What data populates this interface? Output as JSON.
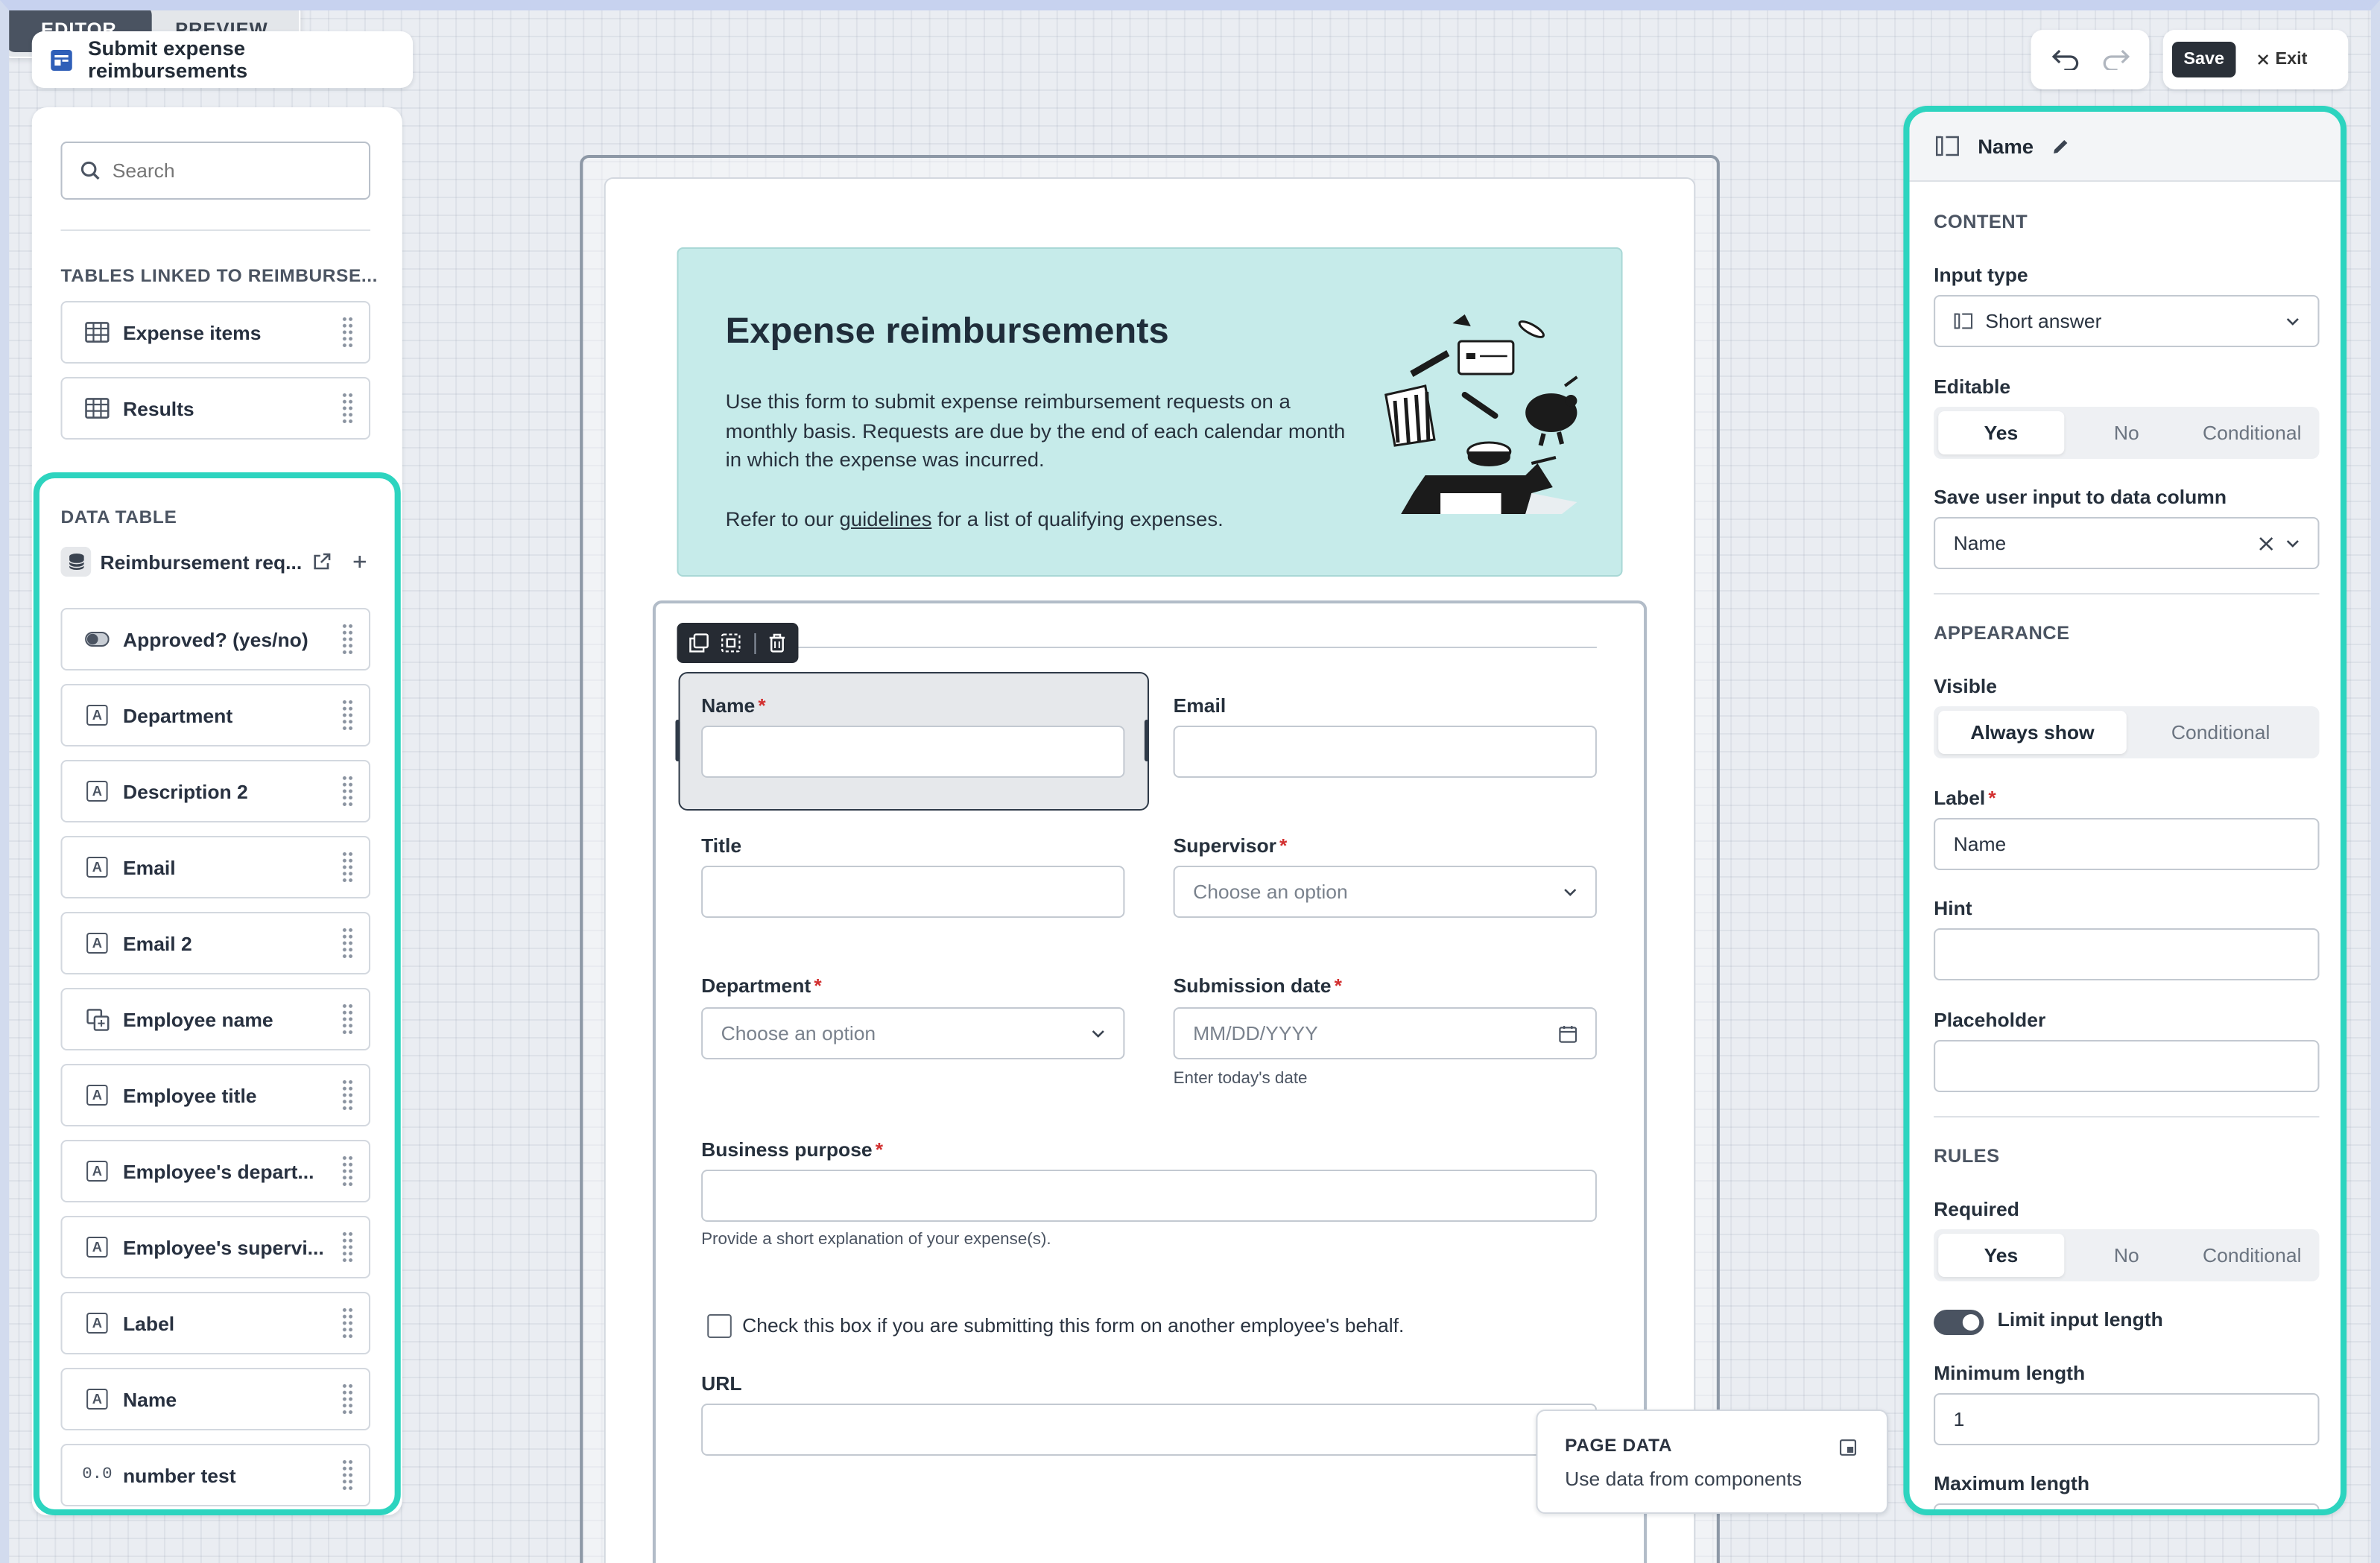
{
  "app": {
    "title": "Submit expense reimbursements"
  },
  "tabs": {
    "editor": "EDITOR",
    "preview": "PREVIEW"
  },
  "actions": {
    "save": "Save",
    "exit": "Exit"
  },
  "left": {
    "search_placeholder": "Search",
    "linked_heading": "TABLES LINKED TO REIMBURSE...",
    "linked_tables": [
      {
        "label": "Expense items"
      },
      {
        "label": "Results"
      }
    ],
    "data_table_heading": "DATA TABLE",
    "data_table_name": "Reimbursement req...",
    "fields": [
      {
        "label": "Approved? (yes/no)",
        "icon": "toggle-icon"
      },
      {
        "label": "Department",
        "icon": "text-field-icon"
      },
      {
        "label": "Description 2",
        "icon": "text-field-icon"
      },
      {
        "label": "Email",
        "icon": "text-field-icon"
      },
      {
        "label": "Email 2",
        "icon": "text-field-icon"
      },
      {
        "label": "Employee name",
        "icon": "linked-record-icon"
      },
      {
        "label": "Employee title",
        "icon": "text-field-icon"
      },
      {
        "label": "Employee's depart...",
        "icon": "text-field-icon"
      },
      {
        "label": "Employee's supervi...",
        "icon": "text-field-icon"
      },
      {
        "label": "Label",
        "icon": "text-field-icon"
      },
      {
        "label": "Name",
        "icon": "text-field-icon"
      },
      {
        "label": "number test",
        "icon": "number-icon",
        "icon_text": "0.0"
      }
    ]
  },
  "form": {
    "hero_title": "Expense reimbursements",
    "hero_text": "Use this form to submit expense reimbursement requests on a monthly basis. Requests are due by the end of each calendar month in which the expense was incurred.",
    "hero_text2_before": "Refer to our ",
    "hero_link": "guidelines",
    "hero_text2_after": " for a list of qualifying expenses.",
    "name_label": "Name",
    "email_label": "Email",
    "title_label": "Title",
    "supervisor_label": "Supervisor",
    "supervisor_placeholder": "Choose an option",
    "department_label": "Department",
    "department_placeholder": "Choose an option",
    "submission_label": "Submission date",
    "submission_placeholder": "MM/DD/YYYY",
    "submission_hint": "Enter today's date",
    "purpose_label": "Business purpose",
    "purpose_hint": "Provide a short explanation of your expense(s).",
    "checkbox_label": "Check this box if you are submitting this form on another employee's behalf.",
    "url_label": "URL",
    "required_mark": "*"
  },
  "page_data": {
    "title": "PAGE DATA",
    "subtitle": "Use data from components"
  },
  "right": {
    "header": "Name",
    "content_heading": "CONTENT",
    "input_type_label": "Input type",
    "input_type_value": "Short answer",
    "editable_label": "Editable",
    "editable_options": [
      "Yes",
      "No",
      "Conditional"
    ],
    "editable_selected": "Yes",
    "save_column_label": "Save user input to data column",
    "save_column_value": "Name",
    "appearance_heading": "APPEARANCE",
    "visible_label": "Visible",
    "visible_options": [
      "Always show",
      "Conditional"
    ],
    "label_label": "Label",
    "label_value": "Name",
    "hint_label": "Hint",
    "placeholder_label": "Placeholder",
    "rules_heading": "RULES",
    "required_label": "Required",
    "required_options": [
      "Yes",
      "No",
      "Conditional"
    ],
    "limit_label": "Limit input length",
    "min_label": "Minimum length",
    "min_value": "1",
    "max_label": "Maximum length"
  },
  "colors": {
    "accent": "#2dd4bf",
    "hero_bg": "#c6ebea",
    "required": "#d22f2f",
    "dark": "#4a5361"
  }
}
